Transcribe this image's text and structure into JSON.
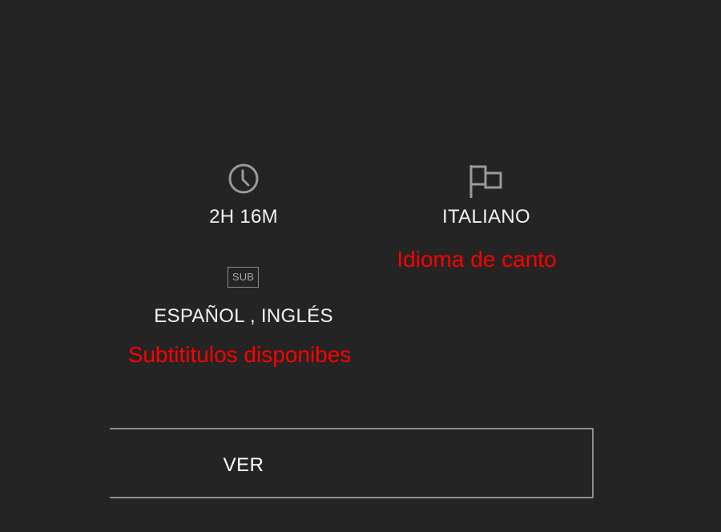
{
  "duration": {
    "icon": "clock-icon",
    "value": "2H 16M"
  },
  "language": {
    "icon": "flag-icon",
    "value": "ITALIANO",
    "annotation": "Idioma de canto"
  },
  "subtitles": {
    "badge": "SUB",
    "value": "ESPAÑOL , INGLÉS",
    "annotation": "Subtititulos disponibes"
  },
  "watch_button": {
    "label": "VER"
  },
  "colors": {
    "background": "#242424",
    "annotation": "#ff0000",
    "icon": "#9a9a9a",
    "border": "#8e8e8e"
  }
}
